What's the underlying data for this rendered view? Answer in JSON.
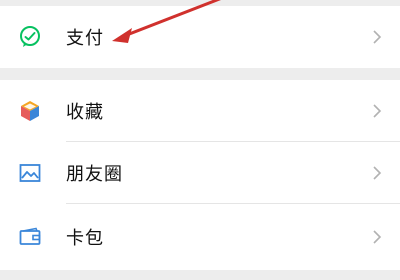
{
  "menu": {
    "items": [
      {
        "key": "payment",
        "label": "支付",
        "icon": "wechat-pay-icon"
      },
      {
        "key": "favorites",
        "label": "收藏",
        "icon": "favorites-cube-icon"
      },
      {
        "key": "moments",
        "label": "朋友圈",
        "icon": "moments-image-icon"
      },
      {
        "key": "cards",
        "label": "卡包",
        "icon": "card-wallet-icon"
      }
    ]
  },
  "colors": {
    "background": "#ededed",
    "row": "#ffffff",
    "text": "#111111",
    "chevron": "#b2b2b2",
    "pay_green": "#07c160",
    "moments_blue": "#3a86d9",
    "annotation_red": "#d0312d"
  }
}
